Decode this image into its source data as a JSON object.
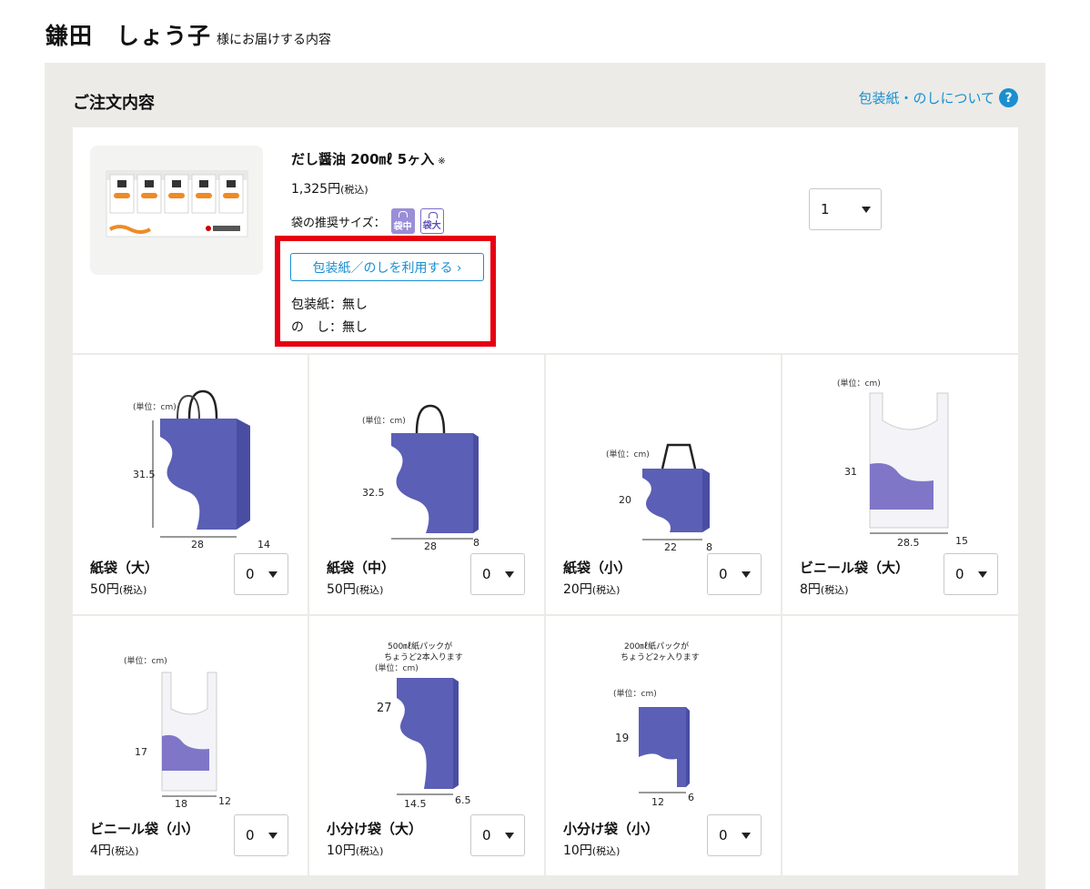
{
  "header": {
    "recipient_name": "鎌田　しょう子",
    "suffix": "様にお届けする内容"
  },
  "order": {
    "title": "ご注文内容",
    "wrap_link_label": "包装紙・のしについて",
    "help_icon": "question-circle-icon"
  },
  "product": {
    "name": "だし醤油 200㎖ 5ヶ入",
    "mark": "※",
    "price": "1,325円",
    "tax_label": "(税込)",
    "bag_size_label": "袋の推奨サイズ：",
    "bag_size_badges": [
      "袋中",
      "袋大"
    ],
    "use_wrap_button": "包装紙／のしを利用する ›",
    "wrap_label": "包装紙：無し",
    "noshi_label": "の　し：無し",
    "quantity": "1"
  },
  "bags": [
    {
      "name": "紙袋（大）",
      "price": "50円",
      "tax": "(税込)",
      "quantity": "0",
      "unit_note": "(単位：cm)",
      "dims": [
        "31.5",
        "28",
        "14"
      ]
    },
    {
      "name": "紙袋（中）",
      "price": "50円",
      "tax": "(税込)",
      "quantity": "0",
      "unit_note": "(単位：cm)",
      "dims": [
        "32.5",
        "28",
        "8"
      ]
    },
    {
      "name": "紙袋（小）",
      "price": "20円",
      "tax": "(税込)",
      "quantity": "0",
      "unit_note": "(単位：cm)",
      "dims": [
        "20",
        "22",
        "8"
      ]
    },
    {
      "name": "ビニール袋（大）",
      "price": "8円",
      "tax": "(税込)",
      "quantity": "0",
      "unit_note": "(単位：cm)",
      "dims": [
        "31",
        "28.5",
        "15"
      ]
    },
    {
      "name": "ビニール袋（小）",
      "price": "4円",
      "tax": "(税込)",
      "quantity": "0",
      "unit_note": "(単位：cm)",
      "dims": [
        "17",
        "18",
        "12"
      ]
    },
    {
      "name": "小分け袋（大）",
      "price": "10円",
      "tax": "(税込)",
      "quantity": "0",
      "unit_note": "(単位：cm)",
      "dims": [
        "27",
        "14.5",
        "6.5"
      ],
      "caption": [
        "500㎖紙パックが",
        "ちょうど2本入ります"
      ]
    },
    {
      "name": "小分け袋（小）",
      "price": "10円",
      "tax": "(税込)",
      "quantity": "0",
      "unit_note": "(単位：cm)",
      "dims": [
        "19",
        "12",
        "6"
      ],
      "caption": [
        "200㎖紙パックが",
        "ちょうど2ヶ入ります"
      ]
    }
  ],
  "colors": {
    "accent": "#1a8fd0",
    "highlight": "#e60012",
    "bag_purple": "#5b5fb5",
    "panel_bg": "#ecebe7"
  }
}
